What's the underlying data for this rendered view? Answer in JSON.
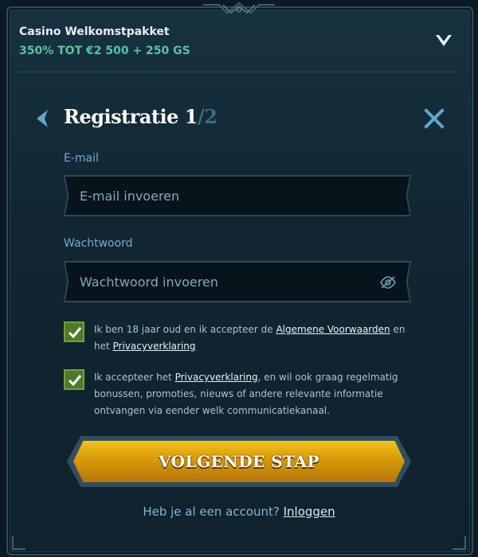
{
  "bonus": {
    "title": "Casino Welkomstpakket",
    "offer": "350% TOT €2 500 + 250 GS",
    "toggle_icon": "chevron-down-icon"
  },
  "registration": {
    "title": "Registratie 1",
    "step_suffix": "/2",
    "back_icon": "chevron-left-icon",
    "close_icon": "close-icon"
  },
  "form": {
    "email": {
      "label": "E-mail",
      "placeholder": "E-mail invoeren",
      "value": ""
    },
    "password": {
      "label": "Wachtwoord",
      "placeholder": "Wachtwoord invoeren",
      "value": "",
      "icon": "eye-off-icon"
    }
  },
  "consents": [
    {
      "checked": true,
      "text_before": "Ik ben 18 jaar oud en ik accepteer de ",
      "link1": "Algemene Voorwaarden",
      "text_mid": " en het ",
      "link2": "Privacyverklaring",
      "text_after": ""
    },
    {
      "checked": true,
      "text_before": "Ik accepteer het ",
      "link1": "Privacyverklaring",
      "text_after": ", en wil ook graag regelmatig bonussen, promoties, nieuws of andere relevante informatie ontvangen via eender welk communicatiekanaal."
    }
  ],
  "cta": {
    "label": "VOLGENDE STAP"
  },
  "footer": {
    "question": "Heb je al een account? ",
    "login_link": "Inloggen"
  },
  "colors": {
    "accent_green": "#59c3a6",
    "cta_gold": "#e0a611",
    "checkbox_green": "#4d7a2a"
  }
}
